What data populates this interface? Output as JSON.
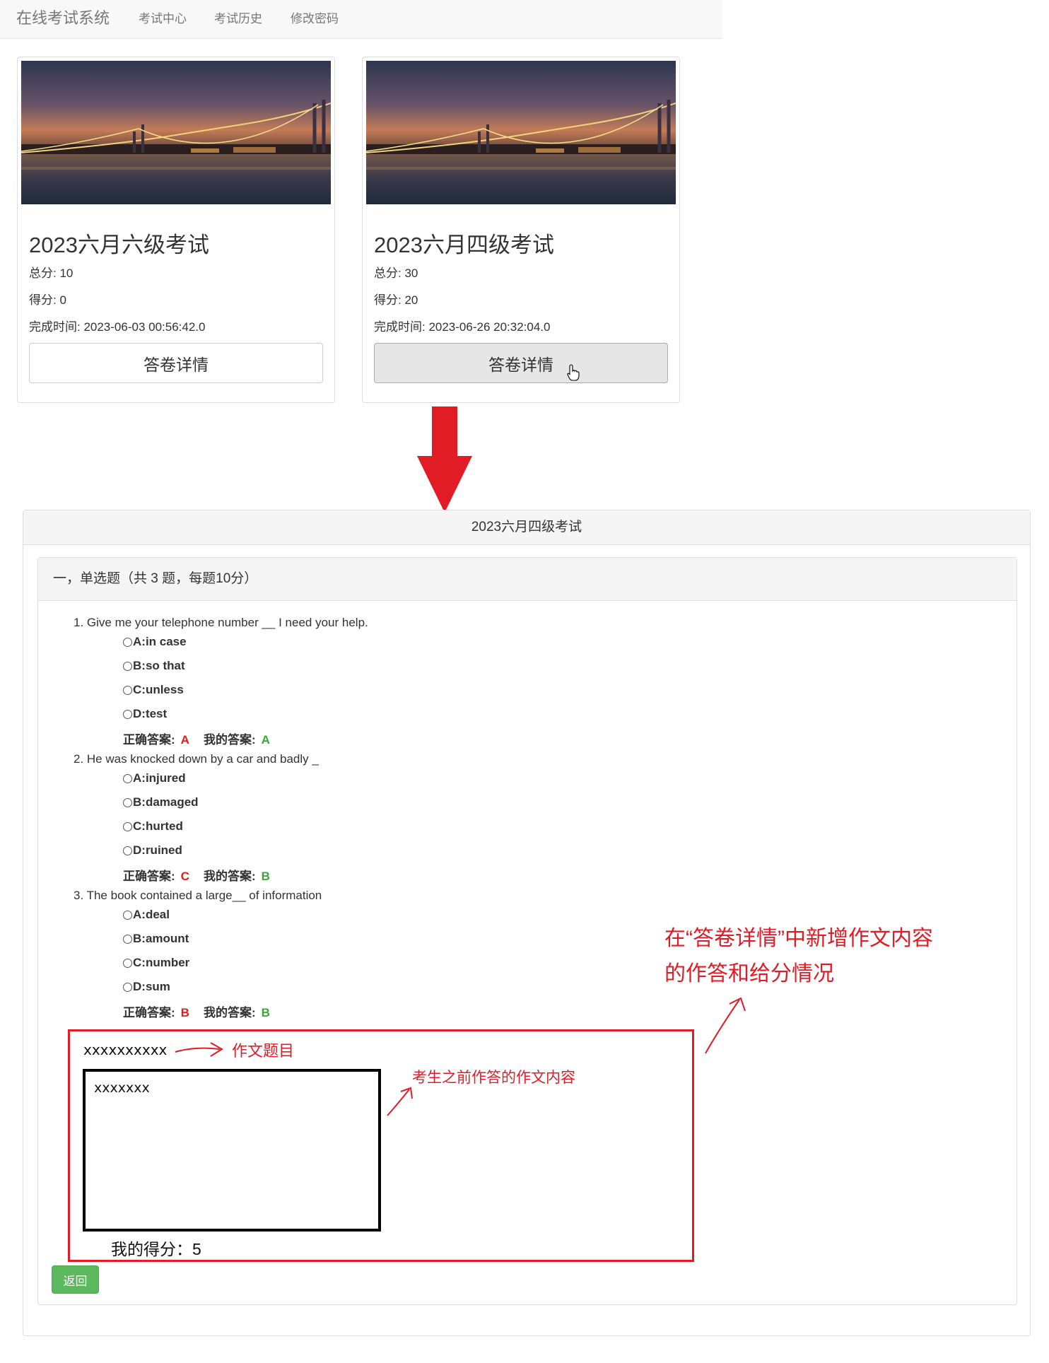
{
  "navbar": {
    "brand": "在线考试系统",
    "links": [
      "考试中心",
      "考试历史",
      "修改密码"
    ]
  },
  "cards": [
    {
      "title": "2023六月六级考试",
      "total": "总分: 10",
      "score": "得分: 0",
      "finished": "完成时间: 2023-06-03 00:56:42.0",
      "button": "答卷详情"
    },
    {
      "title": "2023六月四级考试",
      "total": "总分: 30",
      "score": "得分: 20",
      "finished": "完成时间: 2023-06-26 20:32:04.0",
      "button": "答卷详情"
    }
  ],
  "exam": {
    "title": "2023六月四级考试",
    "section_title": "一，单选题（共 3 题，每题10分）",
    "answer_label_correct": "正确答案:",
    "answer_label_mine": "我的答案:",
    "questions": [
      {
        "text": "1. Give me your telephone number __ I need your help.",
        "options": [
          "A:in case",
          "B:so that",
          "C:unless",
          "D:test"
        ],
        "correct": "A",
        "mine": "A"
      },
      {
        "text": "2. He was knocked down by a car and badly _",
        "options": [
          "A:injured",
          "B:damaged",
          "C:hurted",
          "D:ruined"
        ],
        "correct": "C",
        "mine": "B"
      },
      {
        "text": "3. The book contained a large__ of information",
        "options": [
          "A:deal",
          "B:amount",
          "C:number",
          "D:sum"
        ],
        "correct": "B",
        "mine": "B"
      }
    ],
    "essay": {
      "title": "xxxxxxxxxx",
      "content": "xxxxxxx",
      "score": "我的得分：5"
    },
    "back_button": "返回"
  },
  "annotations": {
    "essay_title_note": "作文题目",
    "essay_content_note": "考生之前作答的作文内容",
    "main_note_line1": "在“答卷详情”中新增作文内容",
    "main_note_line2": "的作答和给分情况"
  },
  "colors": {
    "annotation_red": "#e21c24",
    "correct_answer_red": "#e81c1c",
    "my_answer_green": "#3aa63a",
    "back_button_green": "#5cb85c"
  }
}
